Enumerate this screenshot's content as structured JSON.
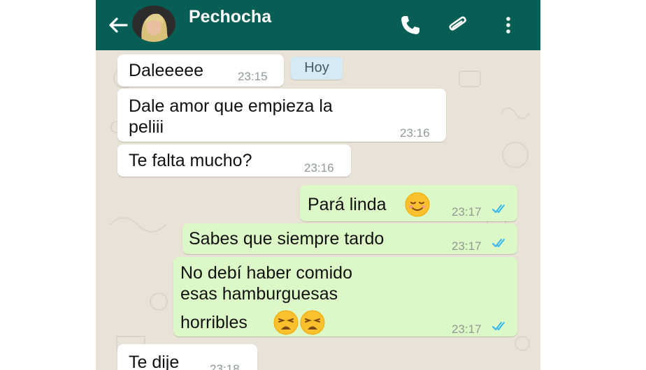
{
  "header": {
    "contact_name": "Pechocha"
  },
  "date_chip": "Hoy",
  "messages": [
    {
      "text": "Daleeeee",
      "time": "23:15"
    },
    {
      "text_line1": "Dale amor que empieza la",
      "text_line2": "peliii",
      "time": "23:16"
    },
    {
      "text": "Te falta mucho?",
      "time": "23:16"
    },
    {
      "text": "Pará linda",
      "time": "23:17",
      "emoji": "relieved-face-icon"
    },
    {
      "text": "Sabes que siempre tardo",
      "time": "23:17"
    },
    {
      "text_line1": "No debí haber comido",
      "text_line2": "esas hamburguesas",
      "text_line3": "horribles",
      "time": "23:17",
      "emoji": "weary-face-icon"
    },
    {
      "text": "Te dije",
      "time": "23:18"
    }
  ],
  "colors": {
    "header": "#075e54",
    "incoming": "#ffffff",
    "outgoing": "#dcf8c6",
    "read_ticks": "#34b7f1"
  }
}
